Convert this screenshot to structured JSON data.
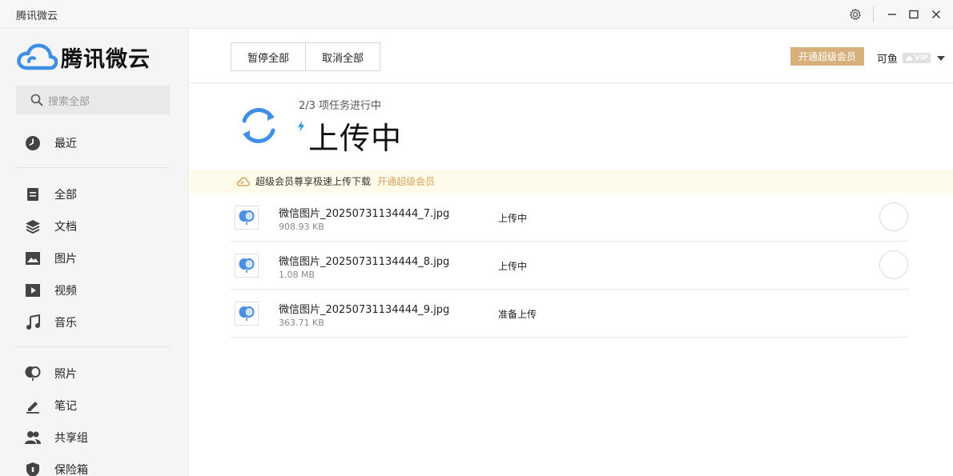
{
  "window": {
    "title": "腾讯微云"
  },
  "brand": {
    "name": "腾讯微云"
  },
  "search": {
    "placeholder": "搜索全部"
  },
  "nav": {
    "recent": "最近",
    "all": "全部",
    "docs": "文档",
    "images": "图片",
    "videos": "视频",
    "music": "音乐",
    "photos": "照片",
    "notes": "笔记",
    "groups": "共享组",
    "vault": "保险箱"
  },
  "toolbar": {
    "pause_all": "暂停全部",
    "cancel_all": "取消全部",
    "vip_button": "开通超级会员",
    "username": "可鱼",
    "vip_badge": "VIP"
  },
  "status": {
    "progress_text": "2/3 项任务进行中",
    "title": "上传中"
  },
  "banner": {
    "text": "超级会员尊享极速上传下载",
    "link": "开通超级会员"
  },
  "files": [
    {
      "name": "微信图片_20250731134444_7.jpg",
      "size": "908.93 KB",
      "status": "上传中"
    },
    {
      "name": "微信图片_20250731134444_8.jpg",
      "size": "1.08 MB",
      "status": "上传中"
    },
    {
      "name": "微信图片_20250731134444_9.jpg",
      "size": "363.71 KB",
      "status": "准备上传"
    }
  ],
  "colors": {
    "accent_blue": "#3f8ee8",
    "vip_gold": "#d8b07c",
    "banner_bg": "#fffbeb"
  }
}
